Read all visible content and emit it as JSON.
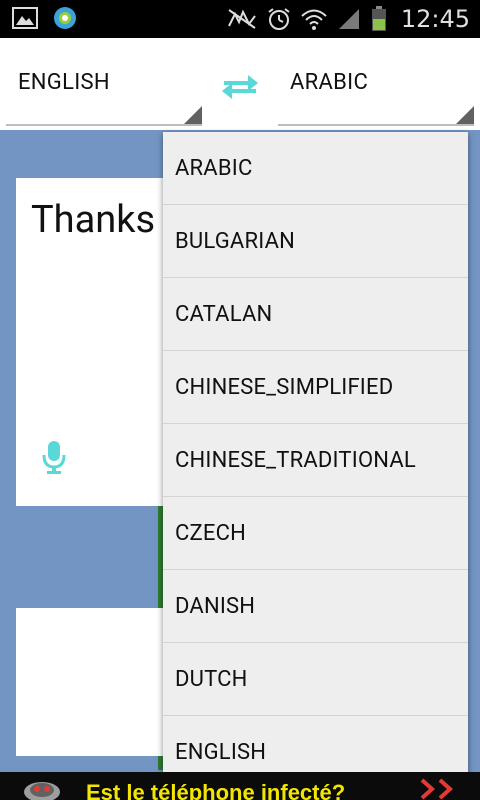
{
  "status_bar": {
    "time": "12:45"
  },
  "language_bar": {
    "source_language": "ENGLISH",
    "target_language": "ARABIC"
  },
  "source": {
    "text": "Thanks"
  },
  "dropdown": {
    "options": [
      "ARABIC",
      "BULGARIAN",
      "CATALAN",
      "CHINESE_SIMPLIFIED",
      "CHINESE_TRADITIONAL",
      "CZECH",
      "DANISH",
      "DUTCH",
      "ENGLISH"
    ]
  },
  "ad": {
    "text": "Est le téléphone infecté?"
  },
  "colors": {
    "accent": "#5ad8d8",
    "content_bg": "#7295c3",
    "ad_text": "#f2e600"
  }
}
